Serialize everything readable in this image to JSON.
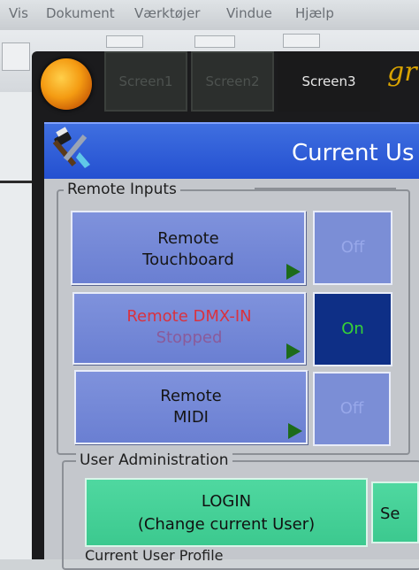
{
  "host_menu": [
    "Vis",
    "Dokument",
    "Værktøjer",
    "Vindue",
    "Hjælp"
  ],
  "tabs": [
    {
      "label": "Screen1",
      "active": false
    },
    {
      "label": "Screen2",
      "active": false
    },
    {
      "label": "Screen3",
      "active": true
    }
  ],
  "brand_text": "gr",
  "header": {
    "title": "Current Us",
    "icon": "tools-icon"
  },
  "remote_inputs": {
    "label": "Remote Inputs",
    "items": [
      {
        "line1": "Remote",
        "line2": "Touchboard",
        "state": "Off"
      },
      {
        "line1": "Remote DMX-IN",
        "line2": "Stopped",
        "state": "On"
      },
      {
        "line1": "Remote",
        "line2": "MIDI",
        "state": "Off"
      }
    ]
  },
  "user_admin": {
    "label": "User Administration",
    "login_line1": "LOGIN",
    "login_line2": "(Change current User)",
    "second_button": "Se"
  },
  "footer_text": "Current User Profile",
  "colors": {
    "title_bar": "#234fd0",
    "button_blue": "#6a7fd2",
    "state_on_bg": "#0e2f86",
    "state_on_text": "#36d336",
    "dmx_label": "#d9323f",
    "login_green": "#3cc98f"
  }
}
